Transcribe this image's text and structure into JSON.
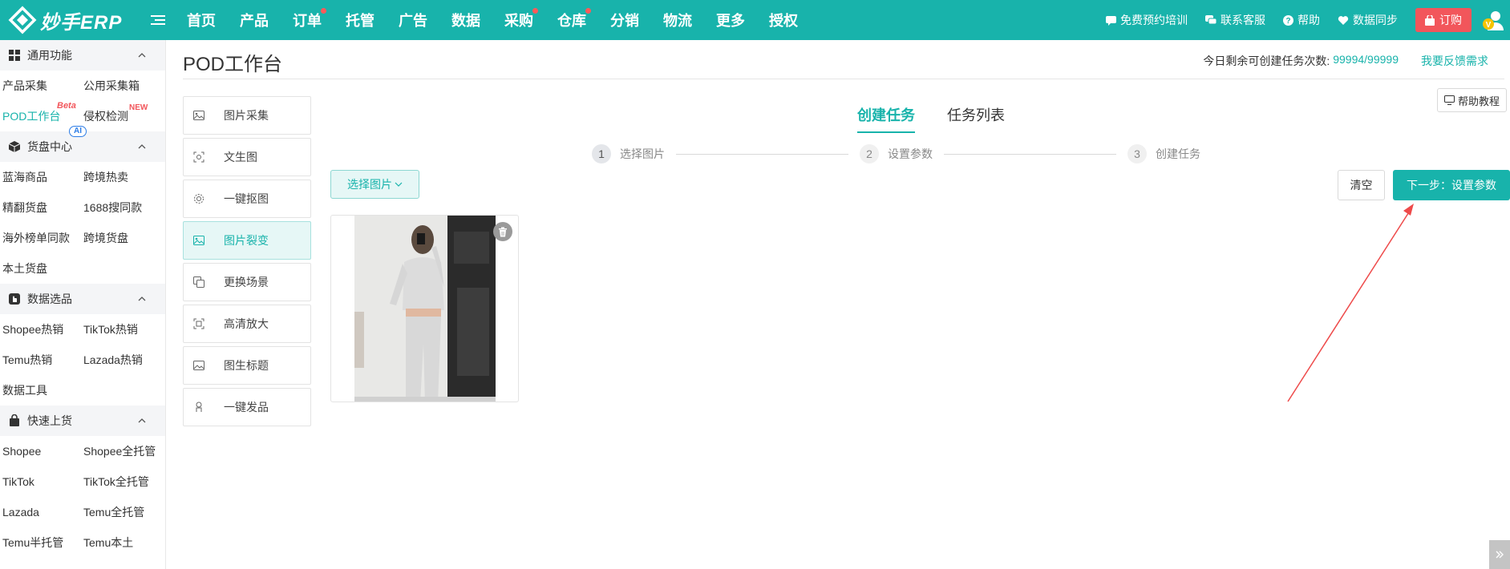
{
  "app": {
    "logo_text": "妙手ERP"
  },
  "topnav": {
    "items": [
      {
        "label": "首页",
        "dot": false
      },
      {
        "label": "产品",
        "dot": false
      },
      {
        "label": "订单",
        "dot": true
      },
      {
        "label": "托管",
        "dot": false
      },
      {
        "label": "广告",
        "dot": false
      },
      {
        "label": "数据",
        "dot": false
      },
      {
        "label": "采购",
        "dot": true
      },
      {
        "label": "仓库",
        "dot": true
      },
      {
        "label": "分销",
        "dot": false
      },
      {
        "label": "物流",
        "dot": false
      },
      {
        "label": "更多",
        "dot": false
      },
      {
        "label": "授权",
        "dot": false
      }
    ],
    "training_label": "免费预约培训",
    "support_label": "联系客服",
    "help_label": "帮助",
    "sync_label": "数据同步",
    "order_label": "订购",
    "avatar_badge": "V"
  },
  "sidebar": {
    "sections": [
      {
        "title": "通用功能",
        "icon": "grid-icon",
        "links": [
          "产品采集",
          "公用采集箱",
          "POD工作台",
          "侵权检测"
        ]
      },
      {
        "title": "货盘中心",
        "icon": "cube-icon",
        "links": [
          "蓝海商品",
          "跨境热卖",
          "精翻货盘",
          "1688搜同款",
          "海外榜单同款",
          "跨境货盘",
          "本土货盘"
        ]
      },
      {
        "title": "数据选品",
        "icon": "hand-icon",
        "links": [
          "Shopee热销",
          "TikTok热销",
          "Temu热销",
          "Lazada热销",
          "数据工具"
        ]
      },
      {
        "title": "快速上货",
        "icon": "bag-icon",
        "links": [
          "Shopee",
          "Shopee全托管",
          "TikTok",
          "TikTok全托管",
          "Lazada",
          "Temu全托管",
          "Temu半托管",
          "Temu本土"
        ]
      }
    ],
    "badges": {
      "beta": "Beta",
      "new": "NEW",
      "ai": "AI"
    }
  },
  "main": {
    "page_title": "POD工作台",
    "quota_label": "今日剩余可创建任务次数:",
    "quota_value": "99994/99999",
    "feedback_label": "我要反馈需求",
    "help_tutorial": "帮助教程",
    "tools": [
      {
        "label": "图片采集",
        "icon": "image-icon",
        "active": false
      },
      {
        "label": "文生图",
        "icon": "text-to-image-icon",
        "active": false
      },
      {
        "label": "一键抠图",
        "icon": "cutout-icon",
        "active": false
      },
      {
        "label": "图片裂变",
        "icon": "image-variation-icon",
        "active": true
      },
      {
        "label": "更换场景",
        "icon": "scene-icon",
        "active": false
      },
      {
        "label": "高清放大",
        "icon": "upscale-icon",
        "active": false
      },
      {
        "label": "图生标题",
        "icon": "image-title-icon",
        "active": false
      },
      {
        "label": "一键发品",
        "icon": "publish-icon",
        "active": false
      }
    ],
    "tabs": [
      {
        "label": "创建任务",
        "active": true
      },
      {
        "label": "任务列表",
        "active": false
      }
    ],
    "steps": [
      {
        "num": "1",
        "label": "选择图片",
        "active": true
      },
      {
        "num": "2",
        "label": "设置参数",
        "active": false
      },
      {
        "num": "3",
        "label": "创建任务",
        "active": false
      }
    ],
    "select_image_label": "选择图片",
    "clear_label": "清空",
    "next_label": "下一步：设置参数"
  },
  "colors": {
    "brand": "#18b3ab",
    "order_button": "#f2565b",
    "annotation_arrow": "#ee4a4a"
  }
}
